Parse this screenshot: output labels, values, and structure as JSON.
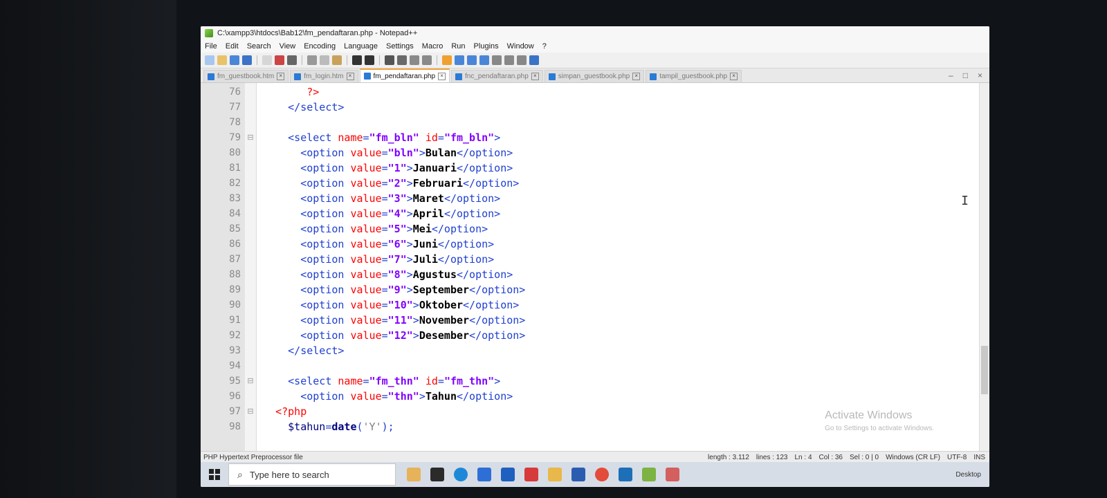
{
  "window": {
    "title": "C:\\xampp3\\htdocs\\Bab12\\fm_pendaftaran.php - Notepad++"
  },
  "menu": [
    "File",
    "Edit",
    "Search",
    "View",
    "Encoding",
    "Language",
    "Settings",
    "Macro",
    "Run",
    "Plugins",
    "Window",
    "?"
  ],
  "tabs": [
    {
      "label": "fm_guestbook.htm",
      "active": false
    },
    {
      "label": "fm_login.htm",
      "active": false
    },
    {
      "label": "fm_pendaftaran.php",
      "active": true
    },
    {
      "label": "fnc_pendaftaran.php",
      "active": false
    },
    {
      "label": "simpan_guestbook.php",
      "active": false
    },
    {
      "label": "tampil_guestbook.php",
      "active": false
    }
  ],
  "editor": {
    "lines": [
      {
        "no": "76",
        "fold": "",
        "code": [
          {
            "t": "        ",
            "c": ""
          },
          {
            "t": "?>",
            "c": "php"
          }
        ]
      },
      {
        "no": "77",
        "fold": "",
        "code": [
          {
            "t": "     ",
            "c": ""
          },
          {
            "t": "</select>",
            "c": "tag"
          }
        ]
      },
      {
        "no": "78",
        "fold": "",
        "code": [
          {
            "t": "",
            "c": ""
          }
        ]
      },
      {
        "no": "79",
        "fold": "⊟",
        "code": [
          {
            "t": "     ",
            "c": ""
          },
          {
            "t": "<select ",
            "c": "tag"
          },
          {
            "t": "name",
            "c": "attr"
          },
          {
            "t": "=",
            "c": "tag"
          },
          {
            "t": "\"fm_bln\"",
            "c": "val"
          },
          {
            "t": " ",
            "c": ""
          },
          {
            "t": "id",
            "c": "attr"
          },
          {
            "t": "=",
            "c": "tag"
          },
          {
            "t": "\"fm_bln\"",
            "c": "val"
          },
          {
            "t": ">",
            "c": "tag"
          }
        ]
      },
      {
        "no": "80",
        "fold": "",
        "code": [
          {
            "t": "       ",
            "c": ""
          },
          {
            "t": "<option ",
            "c": "tag"
          },
          {
            "t": "value",
            "c": "attr"
          },
          {
            "t": "=",
            "c": "tag"
          },
          {
            "t": "\"bln\"",
            "c": "val"
          },
          {
            "t": ">",
            "c": "tag"
          },
          {
            "t": "Bulan",
            "c": "txt"
          },
          {
            "t": "</option>",
            "c": "tag"
          }
        ]
      },
      {
        "no": "81",
        "fold": "",
        "code": [
          {
            "t": "       ",
            "c": ""
          },
          {
            "t": "<option ",
            "c": "tag"
          },
          {
            "t": "value",
            "c": "attr"
          },
          {
            "t": "=",
            "c": "tag"
          },
          {
            "t": "\"1\"",
            "c": "val"
          },
          {
            "t": ">",
            "c": "tag"
          },
          {
            "t": "Januari",
            "c": "txt"
          },
          {
            "t": "</option>",
            "c": "tag"
          }
        ]
      },
      {
        "no": "82",
        "fold": "",
        "code": [
          {
            "t": "       ",
            "c": ""
          },
          {
            "t": "<option ",
            "c": "tag"
          },
          {
            "t": "value",
            "c": "attr"
          },
          {
            "t": "=",
            "c": "tag"
          },
          {
            "t": "\"2\"",
            "c": "val"
          },
          {
            "t": ">",
            "c": "tag"
          },
          {
            "t": "Februari",
            "c": "txt"
          },
          {
            "t": "</option>",
            "c": "tag"
          }
        ]
      },
      {
        "no": "83",
        "fold": "",
        "code": [
          {
            "t": "       ",
            "c": ""
          },
          {
            "t": "<option ",
            "c": "tag"
          },
          {
            "t": "value",
            "c": "attr"
          },
          {
            "t": "=",
            "c": "tag"
          },
          {
            "t": "\"3\"",
            "c": "val"
          },
          {
            "t": ">",
            "c": "tag"
          },
          {
            "t": "Maret",
            "c": "txt"
          },
          {
            "t": "</option>",
            "c": "tag"
          }
        ]
      },
      {
        "no": "84",
        "fold": "",
        "code": [
          {
            "t": "       ",
            "c": ""
          },
          {
            "t": "<option ",
            "c": "tag"
          },
          {
            "t": "value",
            "c": "attr"
          },
          {
            "t": "=",
            "c": "tag"
          },
          {
            "t": "\"4\"",
            "c": "val"
          },
          {
            "t": ">",
            "c": "tag"
          },
          {
            "t": "April",
            "c": "txt"
          },
          {
            "t": "</option>",
            "c": "tag"
          }
        ]
      },
      {
        "no": "85",
        "fold": "",
        "code": [
          {
            "t": "       ",
            "c": ""
          },
          {
            "t": "<option ",
            "c": "tag"
          },
          {
            "t": "value",
            "c": "attr"
          },
          {
            "t": "=",
            "c": "tag"
          },
          {
            "t": "\"5\"",
            "c": "val"
          },
          {
            "t": ">",
            "c": "tag"
          },
          {
            "t": "Mei",
            "c": "txt"
          },
          {
            "t": "</option>",
            "c": "tag"
          }
        ]
      },
      {
        "no": "86",
        "fold": "",
        "code": [
          {
            "t": "       ",
            "c": ""
          },
          {
            "t": "<option ",
            "c": "tag"
          },
          {
            "t": "value",
            "c": "attr"
          },
          {
            "t": "=",
            "c": "tag"
          },
          {
            "t": "\"6\"",
            "c": "val"
          },
          {
            "t": ">",
            "c": "tag"
          },
          {
            "t": "Juni",
            "c": "txt"
          },
          {
            "t": "</option>",
            "c": "tag"
          }
        ]
      },
      {
        "no": "87",
        "fold": "",
        "code": [
          {
            "t": "       ",
            "c": ""
          },
          {
            "t": "<option ",
            "c": "tag"
          },
          {
            "t": "value",
            "c": "attr"
          },
          {
            "t": "=",
            "c": "tag"
          },
          {
            "t": "\"7\"",
            "c": "val"
          },
          {
            "t": ">",
            "c": "tag"
          },
          {
            "t": "Juli",
            "c": "txt"
          },
          {
            "t": "</option>",
            "c": "tag"
          }
        ]
      },
      {
        "no": "88",
        "fold": "",
        "code": [
          {
            "t": "       ",
            "c": ""
          },
          {
            "t": "<option ",
            "c": "tag"
          },
          {
            "t": "value",
            "c": "attr"
          },
          {
            "t": "=",
            "c": "tag"
          },
          {
            "t": "\"8\"",
            "c": "val"
          },
          {
            "t": ">",
            "c": "tag"
          },
          {
            "t": "Agustus",
            "c": "txt"
          },
          {
            "t": "</option>",
            "c": "tag"
          }
        ]
      },
      {
        "no": "89",
        "fold": "",
        "code": [
          {
            "t": "       ",
            "c": ""
          },
          {
            "t": "<option ",
            "c": "tag"
          },
          {
            "t": "value",
            "c": "attr"
          },
          {
            "t": "=",
            "c": "tag"
          },
          {
            "t": "\"9\"",
            "c": "val"
          },
          {
            "t": ">",
            "c": "tag"
          },
          {
            "t": "September",
            "c": "txt"
          },
          {
            "t": "</option>",
            "c": "tag"
          }
        ]
      },
      {
        "no": "90",
        "fold": "",
        "code": [
          {
            "t": "       ",
            "c": ""
          },
          {
            "t": "<option ",
            "c": "tag"
          },
          {
            "t": "value",
            "c": "attr"
          },
          {
            "t": "=",
            "c": "tag"
          },
          {
            "t": "\"10\"",
            "c": "val"
          },
          {
            "t": ">",
            "c": "tag"
          },
          {
            "t": "Oktober",
            "c": "txt"
          },
          {
            "t": "</option>",
            "c": "tag"
          }
        ]
      },
      {
        "no": "91",
        "fold": "",
        "code": [
          {
            "t": "       ",
            "c": ""
          },
          {
            "t": "<option ",
            "c": "tag"
          },
          {
            "t": "value",
            "c": "attr"
          },
          {
            "t": "=",
            "c": "tag"
          },
          {
            "t": "\"11\"",
            "c": "val"
          },
          {
            "t": ">",
            "c": "tag"
          },
          {
            "t": "November",
            "c": "txt"
          },
          {
            "t": "</option>",
            "c": "tag"
          }
        ]
      },
      {
        "no": "92",
        "fold": "",
        "code": [
          {
            "t": "       ",
            "c": ""
          },
          {
            "t": "<option ",
            "c": "tag"
          },
          {
            "t": "value",
            "c": "attr"
          },
          {
            "t": "=",
            "c": "tag"
          },
          {
            "t": "\"12\"",
            "c": "val"
          },
          {
            "t": ">",
            "c": "tag"
          },
          {
            "t": "Desember",
            "c": "txt"
          },
          {
            "t": "</option>",
            "c": "tag"
          }
        ]
      },
      {
        "no": "93",
        "fold": "",
        "code": [
          {
            "t": "     ",
            "c": ""
          },
          {
            "t": "</select>",
            "c": "tag"
          }
        ]
      },
      {
        "no": "94",
        "fold": "",
        "code": [
          {
            "t": "",
            "c": ""
          }
        ]
      },
      {
        "no": "95",
        "fold": "⊟",
        "code": [
          {
            "t": "     ",
            "c": ""
          },
          {
            "t": "<select ",
            "c": "tag"
          },
          {
            "t": "name",
            "c": "attr"
          },
          {
            "t": "=",
            "c": "tag"
          },
          {
            "t": "\"fm_thn\"",
            "c": "val"
          },
          {
            "t": " ",
            "c": ""
          },
          {
            "t": "id",
            "c": "attr"
          },
          {
            "t": "=",
            "c": "tag"
          },
          {
            "t": "\"fm_thn\"",
            "c": "val"
          },
          {
            "t": ">",
            "c": "tag"
          }
        ]
      },
      {
        "no": "96",
        "fold": "",
        "code": [
          {
            "t": "       ",
            "c": ""
          },
          {
            "t": "<option ",
            "c": "tag"
          },
          {
            "t": "value",
            "c": "attr"
          },
          {
            "t": "=",
            "c": "tag"
          },
          {
            "t": "\"thn\"",
            "c": "val"
          },
          {
            "t": ">",
            "c": "tag"
          },
          {
            "t": "Tahun",
            "c": "txt"
          },
          {
            "t": "</option>",
            "c": "tag"
          }
        ]
      },
      {
        "no": "97",
        "fold": "⊟",
        "code": [
          {
            "t": "   ",
            "c": ""
          },
          {
            "t": "<?php",
            "c": "php"
          }
        ]
      },
      {
        "no": "98",
        "fold": "",
        "code": [
          {
            "t": "     ",
            "c": ""
          },
          {
            "t": "$tahun",
            "c": "var"
          },
          {
            "t": "=",
            "c": "tag"
          },
          {
            "t": "date",
            "c": "fn"
          },
          {
            "t": "(",
            "c": "tag"
          },
          {
            "t": "'Y'",
            "c": "str"
          },
          {
            "t": ");",
            "c": "tag"
          }
        ]
      }
    ]
  },
  "watermark": {
    "title": "Activate Windows",
    "subtitle": "Go to Settings to activate Windows."
  },
  "status": {
    "filetype": "PHP Hypertext Preprocessor file",
    "length": "length : 3.112",
    "lines": "lines : 123",
    "ln": "Ln : 4",
    "col": "Col : 36",
    "sel": "Sel : 0 | 0",
    "eol": "Windows (CR LF)",
    "encoding": "UTF-8",
    "mode": "INS"
  },
  "taskbar": {
    "search_placeholder": "Type here to search",
    "desktop_label": "Desktop"
  }
}
